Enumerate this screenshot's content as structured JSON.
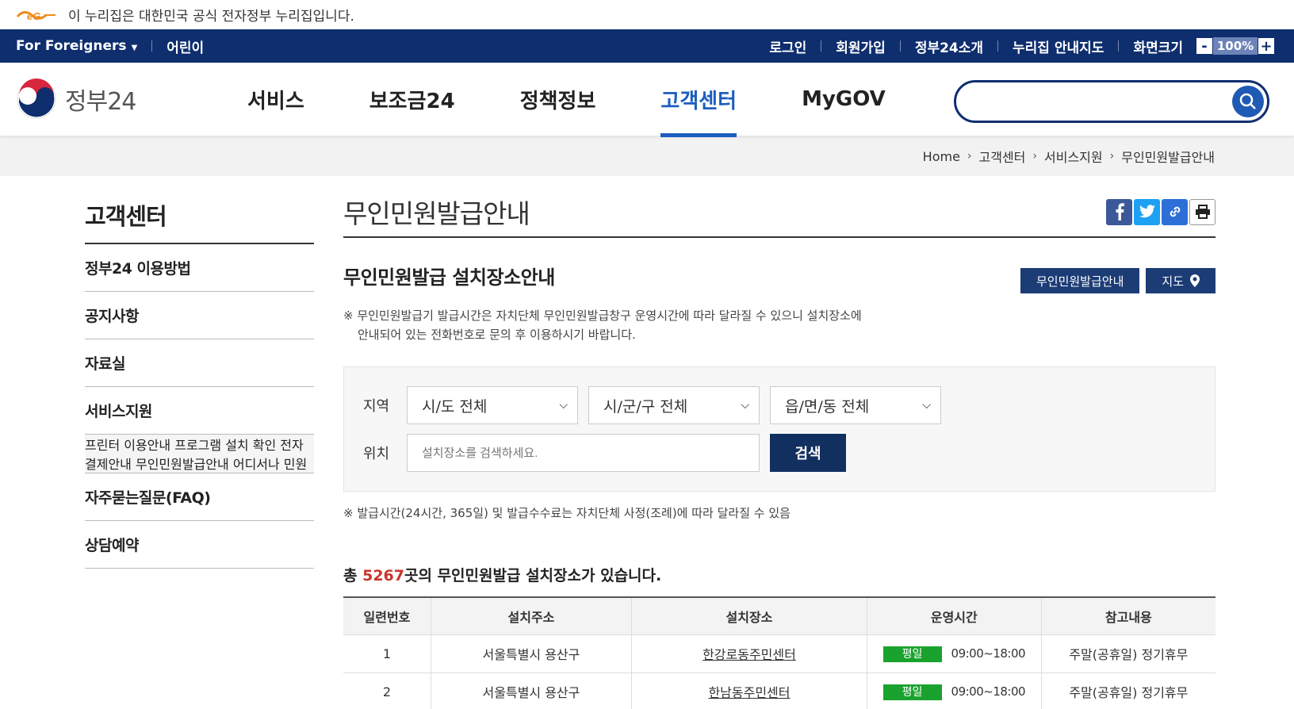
{
  "gov_banner": {
    "text": "이 누리집은 대한민국 공식 전자정부 누리집입니다."
  },
  "utility": {
    "foreigners": "For Foreigners",
    "kids": "어린이",
    "links": [
      "로그인",
      "회원가입",
      "정부24소개",
      "누리집 안내지도"
    ],
    "zoom_label": "화면크기",
    "zoom_value": "100%",
    "zoom_minus": "-",
    "zoom_plus": "+"
  },
  "header": {
    "logo_text": "정부24",
    "nav": [
      "서비스",
      "보조금24",
      "정책정보",
      "고객센터",
      "MyGOV"
    ],
    "active_nav": "고객센터",
    "search_placeholder": ""
  },
  "breadcrumb": [
    "Home",
    "고객센터",
    "서비스지원",
    "무인민원발급안내"
  ],
  "sidebar": {
    "title": "고객센터",
    "menu_top": [
      "정부24 이용방법",
      "공지사항",
      "자료실",
      "서비스지원"
    ],
    "sub": [
      "프린터 이용안내",
      "프로그램 설치 확인",
      "전자결제안내",
      "무인민원발급안내",
      "어디서나 민원"
    ],
    "active_sub": "무인민원발급안내",
    "menu_bottom": [
      "자주묻는질문(FAQ)",
      "상담예약"
    ]
  },
  "content": {
    "page_title": "무인민원발급안내",
    "share_icons": [
      "facebook-icon",
      "twitter-icon",
      "link-icon",
      "print-icon"
    ],
    "section_title": "무인민원발급 설치장소안내",
    "btn_guide": "무인민원발급안내",
    "btn_map": "지도",
    "notice_line1": "※ 무인민원발급기 발급시간은 자치단체 무인민원발급창구 운영시간에 따라 달라질 수 있으니 설치장소에",
    "notice_line2": "안내되어 있는 전화번호로 문의 후 이용하시기 바랍니다.",
    "filter": {
      "region_label": "지역",
      "sido": "시/도 전체",
      "sigungu": "시/군/구 전체",
      "eupmyeondong": "읍/면/동 전체",
      "location_label": "위치",
      "location_placeholder": "설치장소를 검색하세요.",
      "search_btn": "검색"
    },
    "notice2": "※ 발급시간(24시간, 365일) 및 발급수수료는 자치단체 사정(조례)에 따라 달라질 수 있음",
    "count_prefix": "총 ",
    "count_value": "5267",
    "count_suffix": "곳의 무인민원발급 설치장소가 있습니다.",
    "table": {
      "headers": [
        "일련번호",
        "설치주소",
        "설치장소",
        "운영시간",
        "참고내용"
      ],
      "rows": [
        {
          "no": "1",
          "address": "서울특별시 용산구",
          "place": "한강로동주민센터",
          "day": "평일",
          "time": "09:00~18:00",
          "note": "주말(공휴일) 정기휴무"
        },
        {
          "no": "2",
          "address": "서울특별시 용산구",
          "place": "한남동주민센터",
          "day": "평일",
          "time": "09:00~18:00",
          "note": "주말(공휴일) 정기휴무"
        }
      ]
    }
  },
  "colors": {
    "navy": "#0e2e6e",
    "accent_blue": "#1c5dbf",
    "active_red": "#f43f34",
    "count_red": "#c8352a",
    "tag_green": "#1aa22e"
  }
}
